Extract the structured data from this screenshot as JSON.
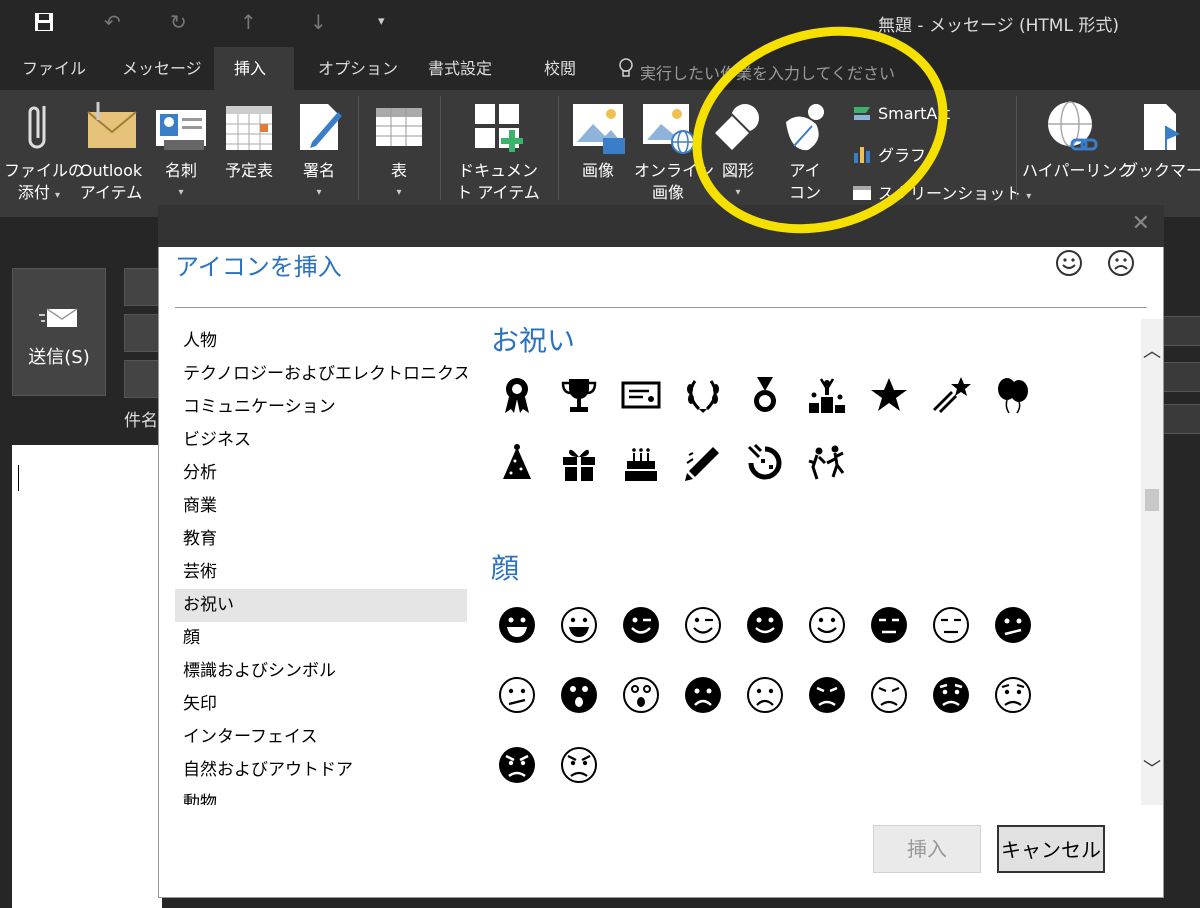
{
  "window": {
    "title": "無題  -  メッセージ (HTML 形式)"
  },
  "quick_access": [
    "save-icon",
    "undo-icon",
    "redo-icon",
    "up-icon",
    "down-icon",
    "customize-icon"
  ],
  "tabs": [
    {
      "label": "ファイル"
    },
    {
      "label": "メッセージ"
    },
    {
      "label": "挿入"
    },
    {
      "label": "オプション"
    },
    {
      "label": "書式設定"
    },
    {
      "label": "校閲"
    }
  ],
  "active_tab": "挿入",
  "tell_me": "実行したい作業を入力してください",
  "ribbon": {
    "attach_file": [
      "ファイルの",
      "添付"
    ],
    "outlook_item": [
      "Outlook",
      "アイテム"
    ],
    "business_card": "名刺",
    "calendar": "予定表",
    "signature": "署名",
    "table": "表",
    "document_item": [
      "ドキュメン",
      "ト アイテム"
    ],
    "pictures": "画像",
    "online_pictures": [
      "オンライン",
      "画像"
    ],
    "shapes": "図形",
    "icons": [
      "アイ",
      "コン"
    ],
    "smartart": "SmartArt",
    "chart": "グラフ",
    "screenshot": "スクリーンショット",
    "hyperlink": "ハイパーリンク",
    "bookmark": "ブックマーク"
  },
  "compose": {
    "send": "送信(S)",
    "subject": "件名"
  },
  "dialog": {
    "title": "アイコンを挿入",
    "categories": [
      "人物",
      "テクノロジーおよびエレクトロニクス",
      "コミュニケーション",
      "ビジネス",
      "分析",
      "商業",
      "教育",
      "芸術",
      "お祝い",
      "顔",
      "標識およびシンボル",
      "矢印",
      "インターフェイス",
      "自然およびアウトドア",
      "動物"
    ],
    "selected_category": "お祝い",
    "sections": [
      {
        "title": "お祝い",
        "icons": [
          "ribbon-award-icon",
          "trophy-icon",
          "certificate-icon",
          "laurel-wreath-icon",
          "medal-icon",
          "podium-icon",
          "star-icon",
          "shooting-star-icon",
          "balloons-icon",
          "party-hat-icon",
          "gift-icon",
          "birthday-cake-icon",
          "party-popper-icon",
          "confetti-icon",
          "dancing-people-icon"
        ]
      },
      {
        "title": "顔",
        "icons": [
          "grin-face-icon",
          "grin-face-outline-icon",
          "wink-face-icon",
          "wink-face-outline-icon",
          "smile-face-icon",
          "smile-face-outline-icon",
          "neutral-face-icon",
          "neutral-face-outline-icon",
          "confused-face-icon",
          "confused-face-outline-icon",
          "surprised-face-icon",
          "surprised-face-outline-icon",
          "sad-face-icon",
          "sad-face-outline-icon",
          "frown-face-icon",
          "frown-face-outline-icon",
          "worried-face-icon",
          "worried-face-outline-icon",
          "angry-face-icon",
          "angry-face-outline-icon"
        ]
      }
    ],
    "insert_button": "挿入",
    "cancel_button": "キャンセル"
  },
  "colors": {
    "accent": "#2b72c0",
    "annotation": "#f5e000",
    "dark_bg": "#262626",
    "ribbon_bg": "#3a3a3a"
  }
}
